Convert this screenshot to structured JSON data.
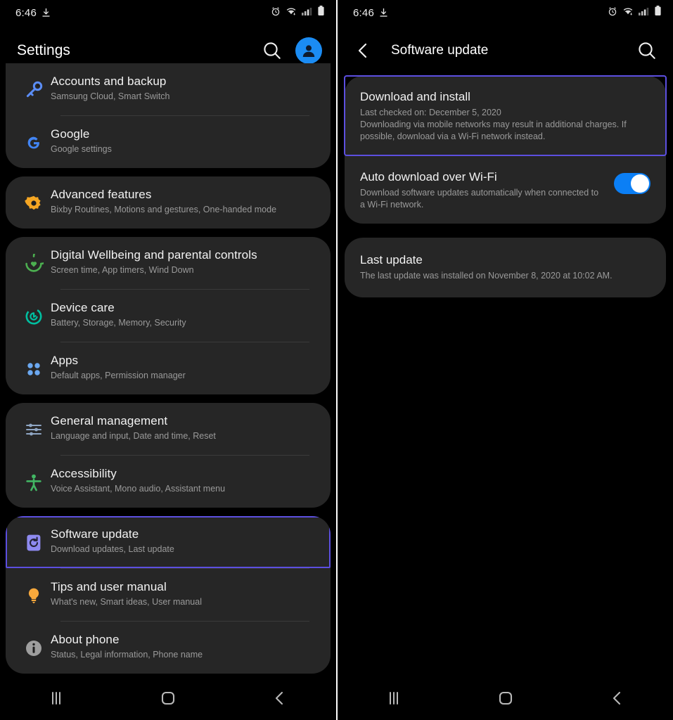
{
  "statusbar": {
    "time": "6:46",
    "icons": [
      "download-icon",
      "alarm-icon",
      "wifi-icon",
      "signal-icon",
      "battery-icon"
    ]
  },
  "left": {
    "appbar": {
      "title": "Settings",
      "search": "search-icon",
      "account": "account-avatar"
    },
    "groups": [
      {
        "items": [
          {
            "icon": "key-icon",
            "title": "Accounts and backup",
            "subtitle": "Samsung Cloud, Smart Switch"
          },
          {
            "icon": "google-icon",
            "title": "Google",
            "subtitle": "Google settings"
          }
        ]
      },
      {
        "items": [
          {
            "icon": "advanced-features-icon",
            "title": "Advanced features",
            "subtitle": "Bixby Routines, Motions and gestures, One-handed mode"
          }
        ]
      },
      {
        "items": [
          {
            "icon": "digital-wellbeing-icon",
            "title": "Digital Wellbeing and parental controls",
            "subtitle": "Screen time, App timers, Wind Down"
          },
          {
            "icon": "device-care-icon",
            "title": "Device care",
            "subtitle": "Battery, Storage, Memory, Security"
          },
          {
            "icon": "apps-icon",
            "title": "Apps",
            "subtitle": "Default apps, Permission manager"
          }
        ]
      },
      {
        "items": [
          {
            "icon": "general-management-icon",
            "title": "General management",
            "subtitle": "Language and input, Date and time, Reset"
          },
          {
            "icon": "accessibility-icon",
            "title": "Accessibility",
            "subtitle": "Voice Assistant, Mono audio, Assistant menu"
          }
        ]
      },
      {
        "items": [
          {
            "icon": "software-update-icon",
            "title": "Software update",
            "subtitle": "Download updates, Last update",
            "highlighted": true
          },
          {
            "icon": "tips-icon",
            "title": "Tips and user manual",
            "subtitle": "What's new, Smart ideas, User manual"
          },
          {
            "icon": "about-phone-icon",
            "title": "About phone",
            "subtitle": "Status, Legal information, Phone name"
          }
        ]
      }
    ]
  },
  "right": {
    "appbar": {
      "back": "back-arrow-icon",
      "title": "Software update",
      "search": "search-icon"
    },
    "cards": [
      {
        "rows": [
          {
            "title": "Download and install",
            "lines": [
              "Last checked on: December 5, 2020",
              "Downloading via mobile networks may result in additional charges. If possible, download via a Wi-Fi network instead."
            ],
            "highlighted": true
          },
          {
            "title": "Auto download over Wi-Fi",
            "lines": [
              "Download software updates automatically when connected to a Wi-Fi network."
            ],
            "toggle": "on"
          }
        ]
      },
      {
        "rows": [
          {
            "title": "Last update",
            "lines": [
              "The last update was installed on November 8, 2020 at 10:02 AM."
            ]
          }
        ]
      }
    ]
  },
  "navbar": {
    "recents_label": "recents-icon",
    "home_label": "home-icon",
    "back_label": "back-icon"
  },
  "colors": {
    "accent_blue": "#0b7ff5",
    "highlight_violet": "#5c4fe0",
    "card_bg": "#262626",
    "page_bg": "#000000"
  }
}
